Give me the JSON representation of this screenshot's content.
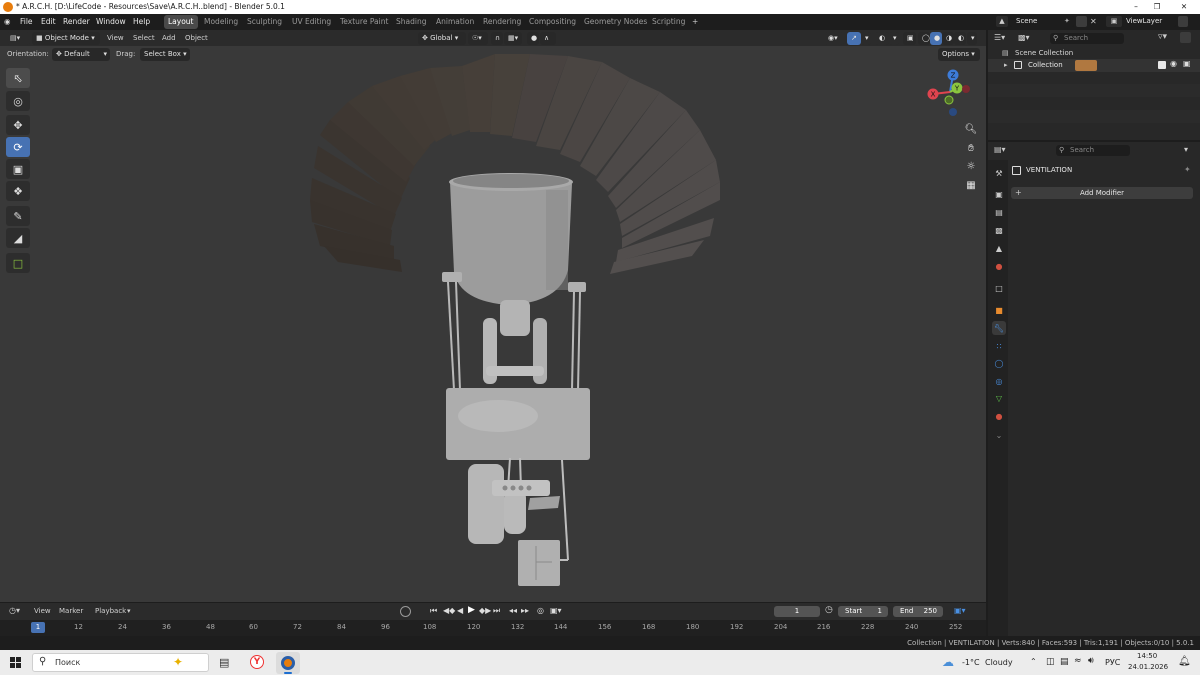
{
  "window": {
    "title": "* A.R.C.H. [D:\\LifeCode - Resources\\Save\\A.R.C.H..blend] - Blender 5.0.1",
    "min": "–",
    "max": "❐",
    "close": "✕"
  },
  "menu": {
    "file": "File",
    "edit": "Edit",
    "render": "Render",
    "window": "Window",
    "help": "Help"
  },
  "workspaces": [
    "Layout",
    "Modeling",
    "Sculpting",
    "UV Editing",
    "Texture Paint",
    "Shading",
    "Animation",
    "Rendering",
    "Compositing",
    "Geometry Nodes",
    "Scripting"
  ],
  "add_workspace": "+",
  "scene": {
    "label": "Scene",
    "view_layer": "ViewLayer"
  },
  "viewport_header": {
    "mode": "Object Mode",
    "view": "View",
    "select": "Select",
    "add": "Add",
    "object": "Object",
    "transform_orientation": "Global"
  },
  "tool_header": {
    "orientation_label": "Orientation:",
    "orientation_value": "Default",
    "drag_label": "Drag:",
    "drag_value": "Select Box",
    "options": "Options"
  },
  "gizmo": {
    "x": "X",
    "y": "Y",
    "z": "Z"
  },
  "outliner": {
    "search_placeholder": "Search",
    "scene_collection": "Scene Collection",
    "collection": "Collection"
  },
  "properties": {
    "search_placeholder": "Search",
    "object_name": "VENTILATION",
    "add_modifier": "Add Modifier",
    "add_icon": "+"
  },
  "timeline": {
    "view": "View",
    "marker": "Marker",
    "playback": "Playback",
    "current_frame": "1",
    "start_label": "Start",
    "start": "1",
    "end_label": "End",
    "end": "250",
    "ticks": [
      "12",
      "24",
      "36",
      "48",
      "60",
      "72",
      "84",
      "96",
      "108",
      "120",
      "132",
      "144",
      "156",
      "168",
      "180",
      "192",
      "204",
      "216",
      "228",
      "240",
      "252"
    ],
    "cursor": "1"
  },
  "status": {
    "text": "Collection | VENTILATION | Verts:840 | Faces:593 | Tris:1,191 | Objects:0/10 | 5.0.1"
  },
  "taskbar": {
    "search": "Поиск",
    "weather": "-1°C",
    "weather_desc": "Cloudy",
    "lang": "РУС",
    "time": "14:50",
    "date": "24.01.2026"
  },
  "colors": {
    "accent": "#4772b3",
    "viewport": "#393939",
    "panel": "#282828",
    "x_axis": "#e0444f",
    "y_axis": "#8bc53f",
    "z_axis": "#3d7cd9"
  }
}
